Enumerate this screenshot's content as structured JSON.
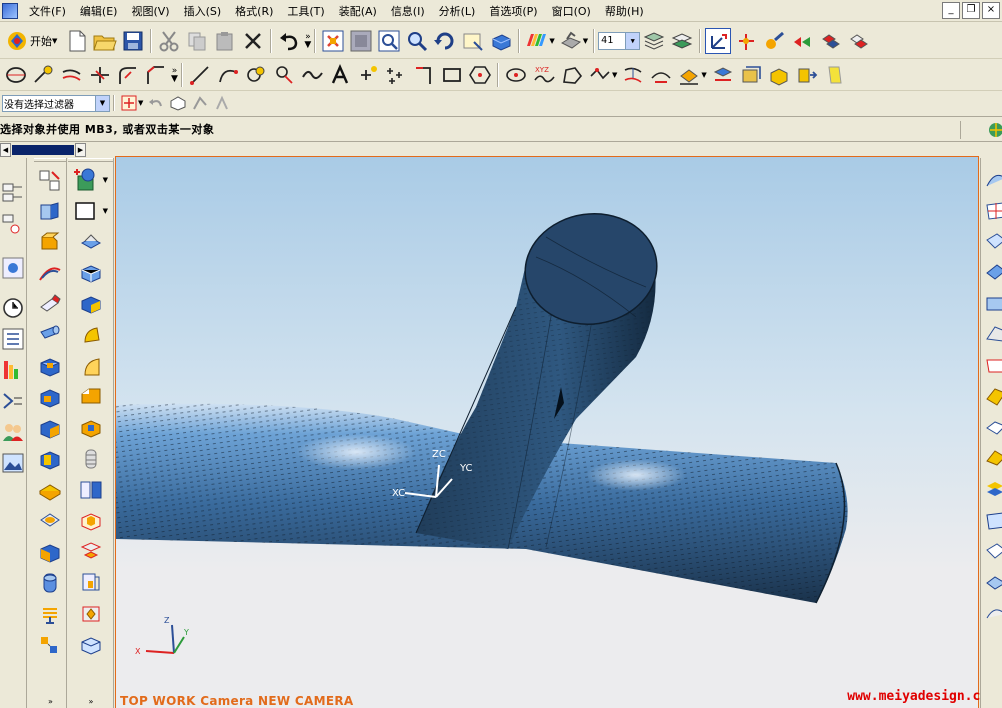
{
  "menu": {
    "items": [
      {
        "label": "文件(F)"
      },
      {
        "label": "编辑(E)"
      },
      {
        "label": "视图(V)"
      },
      {
        "label": "插入(S)"
      },
      {
        "label": "格式(R)"
      },
      {
        "label": "工具(T)"
      },
      {
        "label": "装配(A)"
      },
      {
        "label": "信息(I)"
      },
      {
        "label": "分析(L)"
      },
      {
        "label": "首选项(P)"
      },
      {
        "label": "窗口(O)"
      },
      {
        "label": "帮助(H)"
      }
    ],
    "window_controls": [
      "_",
      "❐",
      "×"
    ]
  },
  "toolbar_standard": {
    "start_label": "开始",
    "layer_value": "41"
  },
  "selection_bar": {
    "filter_value": "没有选择过滤器"
  },
  "cue_line": {
    "text": "选择对象并使用 MB3, 或者双击某一对象"
  },
  "viewport": {
    "wcs_labels": {
      "zc": "ZC",
      "yc": "YC",
      "xc": "XC"
    },
    "abs_labels": {
      "z": "Z",
      "y": "Y",
      "x": "X"
    },
    "camera_label": "TOP WORK Camera NEW CAMERA",
    "watermark": "www.meiyadesign.com",
    "colors": {
      "accent": "#e26b1b",
      "model": "#3c6c9a",
      "background_top": "#a9cbe6",
      "background_bottom": "#ececee"
    }
  },
  "palettes": {
    "footer_chevrons": "»"
  }
}
